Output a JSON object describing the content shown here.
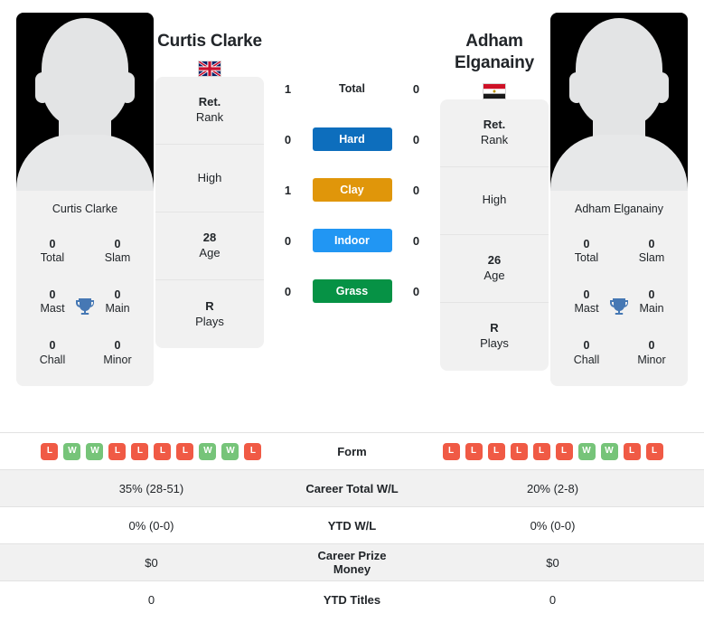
{
  "players": {
    "left": {
      "name": "Curtis Clarke",
      "photo_caption": "Curtis Clarke",
      "flag": "gb-flag",
      "trophies": [
        {
          "value": "0",
          "label": "Total"
        },
        {
          "value": "0",
          "label": "Slam"
        },
        {
          "value": "0",
          "label": "Mast"
        },
        {
          "value": "0",
          "label": "Main"
        },
        {
          "value": "0",
          "label": "Chall"
        },
        {
          "value": "0",
          "label": "Minor"
        }
      ],
      "info": [
        {
          "value": "Ret.",
          "label": "Rank"
        },
        {
          "value": "",
          "label": "High"
        },
        {
          "value": "28",
          "label": "Age"
        },
        {
          "value": "R",
          "label": "Plays"
        }
      ],
      "surface_scores": [
        "1",
        "0",
        "1",
        "0",
        "0"
      ],
      "form": [
        "L",
        "W",
        "W",
        "L",
        "L",
        "L",
        "L",
        "W",
        "W",
        "L"
      ]
    },
    "right": {
      "name": "Adham Elganainy",
      "photo_caption": "Adham Elganainy",
      "flag": "eg-flag",
      "trophies": [
        {
          "value": "0",
          "label": "Total"
        },
        {
          "value": "0",
          "label": "Slam"
        },
        {
          "value": "0",
          "label": "Mast"
        },
        {
          "value": "0",
          "label": "Main"
        },
        {
          "value": "0",
          "label": "Chall"
        },
        {
          "value": "0",
          "label": "Minor"
        }
      ],
      "info": [
        {
          "value": "Ret.",
          "label": "Rank"
        },
        {
          "value": "",
          "label": "High"
        },
        {
          "value": "26",
          "label": "Age"
        },
        {
          "value": "R",
          "label": "Plays"
        }
      ],
      "surface_scores": [
        "0",
        "0",
        "0",
        "0",
        "0"
      ],
      "form": [
        "L",
        "L",
        "L",
        "L",
        "L",
        "L",
        "W",
        "W",
        "L",
        "L"
      ]
    }
  },
  "surfaces": [
    {
      "label": "Total",
      "color": "",
      "plain": true
    },
    {
      "label": "Hard",
      "color": "#0d6ebd",
      "plain": false
    },
    {
      "label": "Clay",
      "color": "#e0960a",
      "plain": false
    },
    {
      "label": "Indoor",
      "color": "#2196f3",
      "plain": false
    },
    {
      "label": "Grass",
      "color": "#069245",
      "plain": false
    }
  ],
  "table": {
    "rows": [
      {
        "label": "Form",
        "left": "",
        "right": "",
        "type": "form",
        "shaded": false
      },
      {
        "label": "Career Total W/L",
        "left": "35% (28-51)",
        "right": "20% (2-8)",
        "type": "text",
        "shaded": true
      },
      {
        "label": "YTD W/L",
        "left": "0% (0-0)",
        "right": "0% (0-0)",
        "type": "text",
        "shaded": false
      },
      {
        "label": "Career Prize Money",
        "left": "$0",
        "right": "$0",
        "type": "text",
        "shaded": true
      },
      {
        "label": "YTD Titles",
        "left": "0",
        "right": "0",
        "type": "text",
        "shaded": false
      }
    ]
  },
  "icons": {
    "trophy": "trophy-icon"
  },
  "colors": {
    "win": "#76c479",
    "loss": "#f05a45",
    "trophy": "#4678b4",
    "panel": "#f1f1f1"
  }
}
